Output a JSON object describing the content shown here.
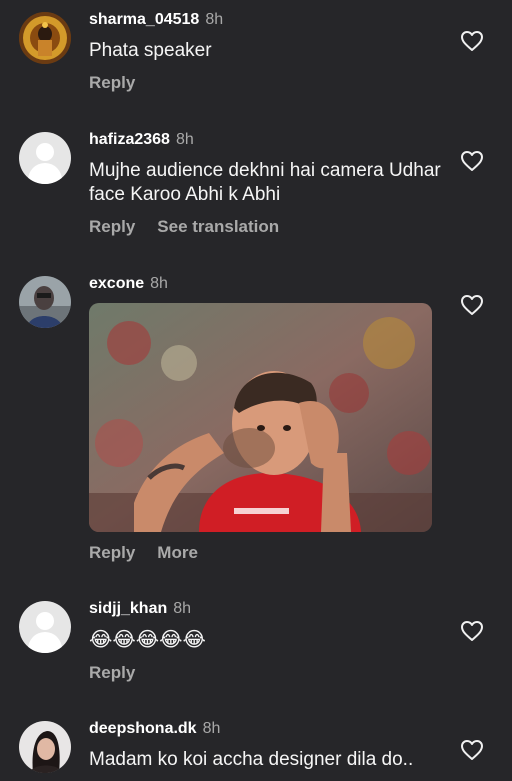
{
  "comments": [
    {
      "username": "sharma_04518",
      "time": "8h",
      "text": "Phata speaker",
      "actions": [
        "Reply"
      ]
    },
    {
      "username": "hafiza2368",
      "time": "8h",
      "text": "Mujhe audience dekhni hai camera Udhar face Karoo Abhi k Abhi",
      "actions": [
        "Reply",
        "See translation"
      ]
    },
    {
      "username": "excone",
      "time": "8h",
      "text": "",
      "actions": [
        "Reply",
        "More"
      ],
      "media": "gif-football-player-holding-head"
    },
    {
      "username": "sidjj_khan",
      "time": "8h",
      "text": "😂😂😂😂😂",
      "actions": [
        "Reply"
      ]
    },
    {
      "username": "deepshona.dk",
      "time": "8h",
      "text": "Madam ko koi accha designer dila do..",
      "actions": []
    }
  ],
  "icons": {
    "like": "heart-outline-icon",
    "default_avatar": "default-avatar-icon"
  },
  "colors": {
    "background": "#262629",
    "text": "#f5f5f5",
    "muted": "#a9a9a9"
  }
}
